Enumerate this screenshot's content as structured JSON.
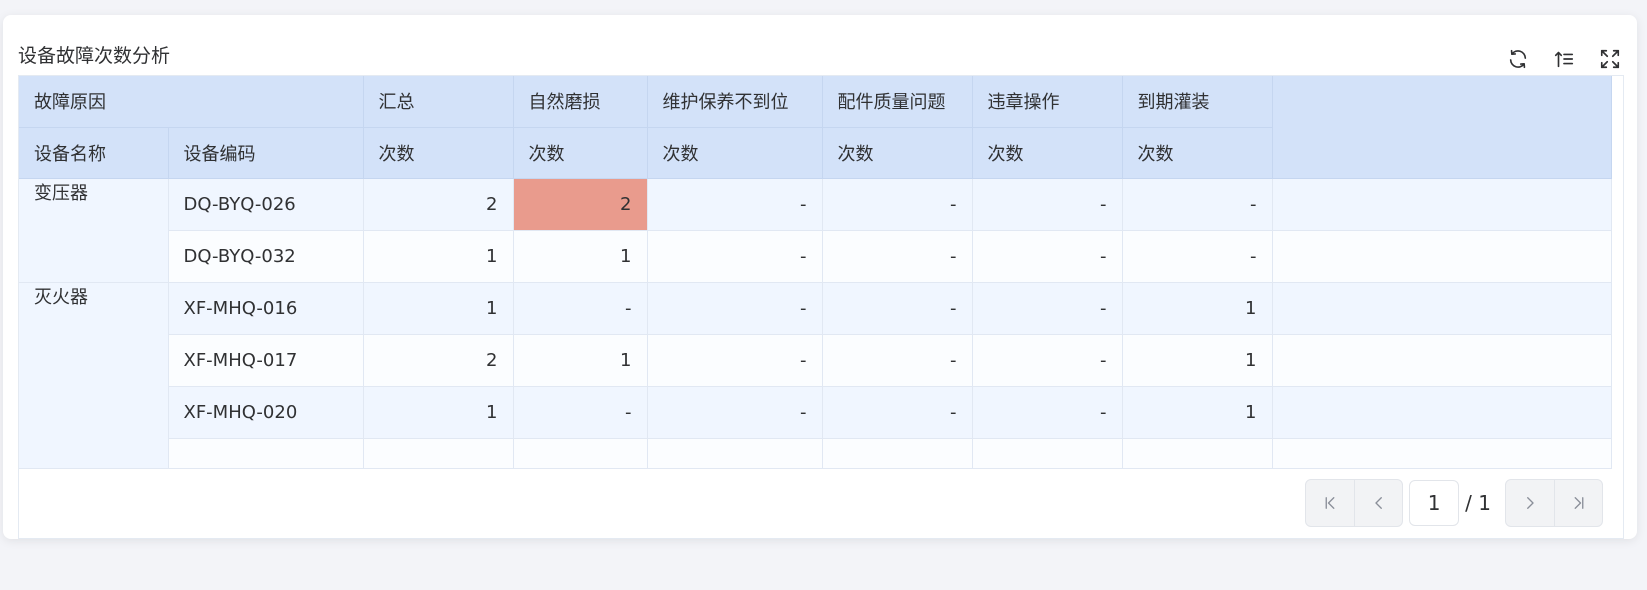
{
  "panel": {
    "title": "设备故障次数分析",
    "tools": [
      {
        "name": "refresh",
        "icon": "refresh-icon"
      },
      {
        "name": "sort",
        "icon": "sort-icon"
      },
      {
        "name": "fullscreen",
        "icon": "fullscreen-icon"
      }
    ]
  },
  "table": {
    "group_header_label": "故障原因",
    "total_label": "汇总",
    "reasons": [
      "自然磨损",
      "维护保养不到位",
      "配件质量问题",
      "违章操作",
      "到期灌装"
    ],
    "sub_headers": {
      "device_name": "设备名称",
      "device_code": "设备编码",
      "count": "次数"
    },
    "rows": [
      {
        "name": "变压器",
        "code": "DQ-BYQ-026",
        "total": "2",
        "values": [
          "2",
          "-",
          "-",
          "-",
          "-"
        ]
      },
      {
        "name": "",
        "code": "DQ-BYQ-032",
        "total": "1",
        "values": [
          "1",
          "-",
          "-",
          "-",
          "-"
        ]
      },
      {
        "name": "灭火器",
        "code": "XF-MHQ-016",
        "total": "1",
        "values": [
          "-",
          "-",
          "-",
          "-",
          "1"
        ]
      },
      {
        "name": "",
        "code": "XF-MHQ-017",
        "total": "2",
        "values": [
          "1",
          "-",
          "-",
          "-",
          "1"
        ]
      },
      {
        "name": "",
        "code": "XF-MHQ-020",
        "total": "1",
        "values": [
          "-",
          "-",
          "-",
          "-",
          "1"
        ]
      }
    ],
    "highlight_color": "#e99b8d"
  },
  "pagination": {
    "current_page": "1",
    "total_label": "/ 1"
  }
}
